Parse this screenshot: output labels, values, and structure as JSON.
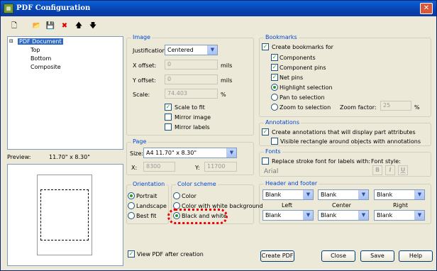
{
  "window": {
    "title": "PDF Configuration",
    "close": "✕",
    "app_icon": "pdf-app-icon"
  },
  "toolbar": {
    "new": "🗋",
    "open": "📂",
    "save": "💾",
    "delete": "✖",
    "up": "🡅",
    "down": "🡇"
  },
  "tree": {
    "root": "PDF Document",
    "children": [
      "Top",
      "Bottom",
      "Composite"
    ]
  },
  "preview": {
    "label": "Preview:",
    "size": "11.70\" x 8.30\""
  },
  "image": {
    "title": "Image",
    "justification_label": "Justification:",
    "justification_value": "Centered",
    "xoffset_label": "X offset:",
    "xoffset_value": "0",
    "xoffset_unit": "mils",
    "yoffset_label": "Y offset:",
    "yoffset_value": "0",
    "yoffset_unit": "mils",
    "scale_label": "Scale:",
    "scale_value": "74.403",
    "scale_unit": "%",
    "scale_to_fit": "Scale to fit",
    "mirror_image": "Mirror image",
    "mirror_labels": "Mirror labels"
  },
  "page": {
    "title": "Page",
    "size_label": "Size:",
    "size_value": "A4  11.70\" x 8.30\"",
    "x_label": "X:",
    "x_value": "8300",
    "y_label": "Y:",
    "y_value": "11700"
  },
  "orientation": {
    "title": "Orientation",
    "options": [
      "Portrait",
      "Landscape",
      "Best fit"
    ]
  },
  "color_scheme": {
    "title": "Color scheme",
    "options": [
      "Color",
      "Color with white background",
      "Black and white"
    ]
  },
  "bookmarks": {
    "title": "Bookmarks",
    "create": "Create bookmarks for",
    "items": [
      "Components",
      "Component pins",
      "Net pins"
    ],
    "radios": [
      "Highlight selection",
      "Pan to selection",
      "Zoom to selection"
    ],
    "zoom_label": "Zoom factor:",
    "zoom_value": "25",
    "zoom_unit": "%"
  },
  "annotations": {
    "title": "Annotations",
    "create": "Create annotations that will display part attributes",
    "visible": "Visible rectangle around objects with annotations"
  },
  "fonts": {
    "title": "Fonts",
    "replace": "Replace stroke font for labels with:",
    "font_style": "Font style:",
    "font_value": "Arial",
    "bold": "B",
    "italic": "I",
    "underline": "U"
  },
  "header_footer": {
    "title": "Header and footer",
    "top": [
      "Blank",
      "Blank",
      "Blank"
    ],
    "labels": [
      "Left",
      "Center",
      "Right"
    ],
    "bottom": [
      "Blank",
      "Blank",
      "Blank"
    ]
  },
  "bottom": {
    "view_pdf": "View PDF after creation",
    "create_pdf": "Create PDF",
    "close": "Close",
    "save": "Save",
    "help": "Help"
  },
  "symbols": {
    "check": "✓",
    "arrow": "▼"
  }
}
